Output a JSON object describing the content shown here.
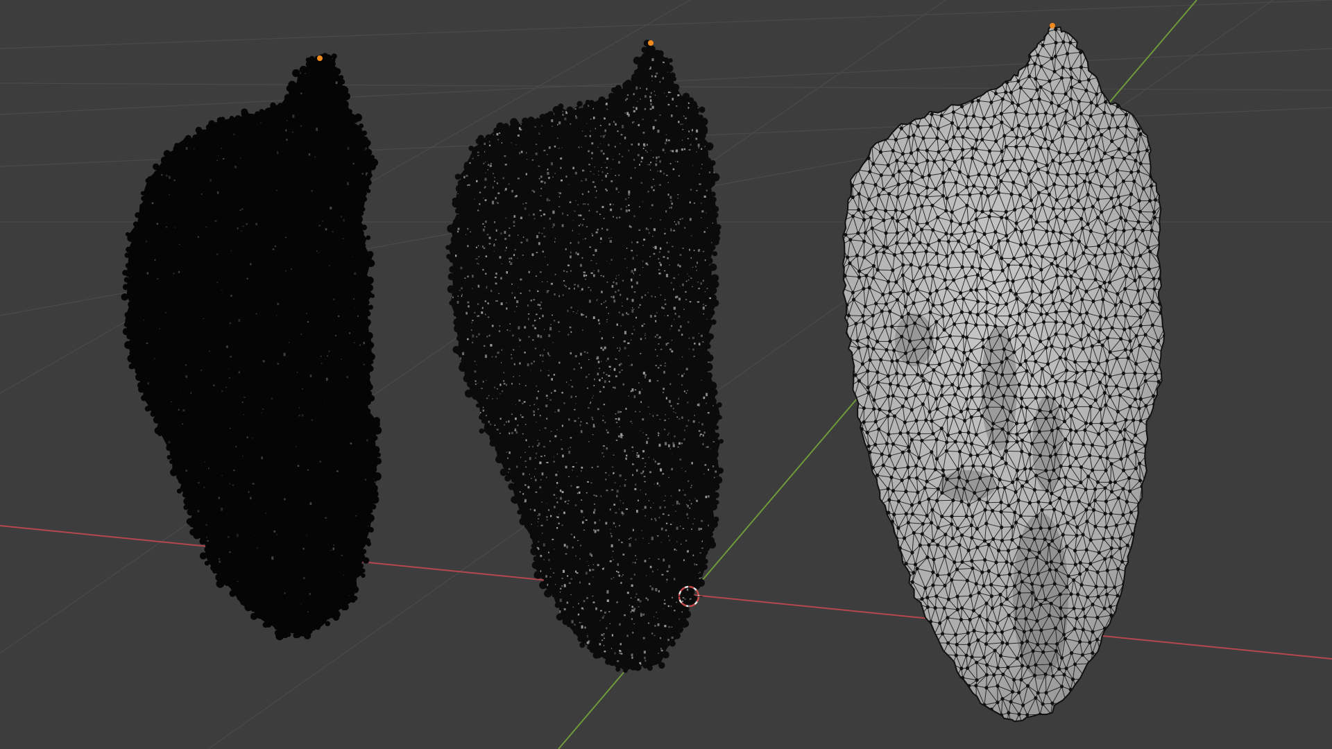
{
  "viewport": {
    "background": "#3d3d3d",
    "grid_color": "#4a4a4a",
    "x_axis_color": "#b5474f",
    "y_axis_color": "#6e9a3a",
    "origin_icon": "3d-cursor-icon",
    "origin_marker_colors": [
      "#c94a4a",
      "#e8e8e8"
    ]
  },
  "objects": [
    {
      "name": "dense-point-cloud",
      "shading": "vertex-heavy",
      "fill_color": "#050505",
      "highlight_color": "#6b6b6b",
      "origin_color": "#f08a1c"
    },
    {
      "name": "sparse-point-cloud",
      "shading": "vertex-speckled",
      "fill_color": "#0b0b0b",
      "highlight_color": "#a8a8a8",
      "origin_color": "#f08a1c"
    },
    {
      "name": "triangulated-mesh",
      "shading": "solid-wireframe",
      "fill_color": "#b9b9b9",
      "wire_color": "#111111",
      "origin_color": "#f08a1c"
    }
  ]
}
